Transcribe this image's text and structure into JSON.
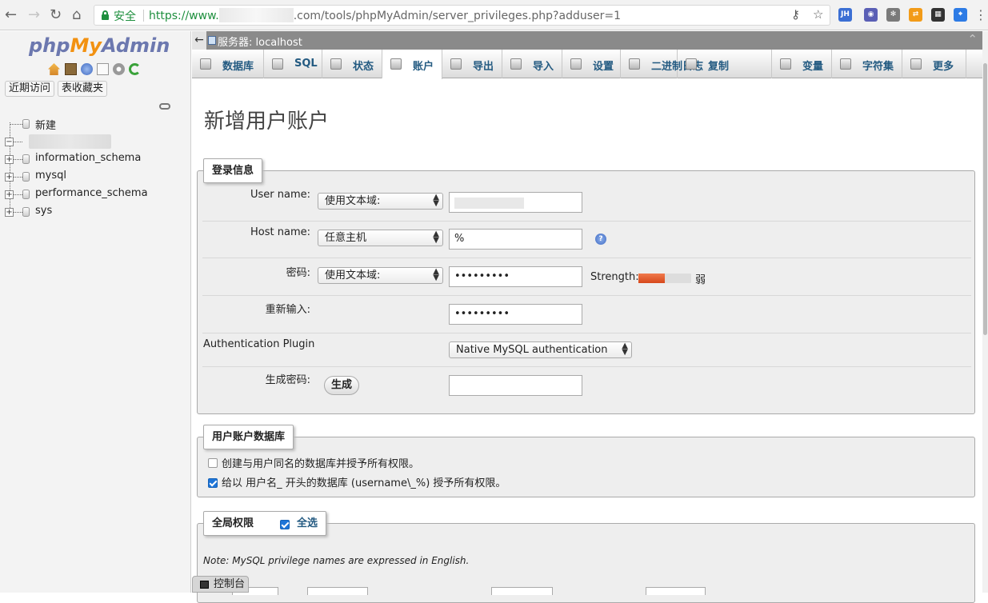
{
  "browser": {
    "secure_label": "安全",
    "url_proto": "https://www.",
    "url_rest": ".com/tools/phpMyAdmin/server_privileges.php?adduser=1",
    "extensions": [
      {
        "label": "JH",
        "color": "#3b6fd4"
      },
      {
        "label": "◉",
        "color": "#5a5fb5"
      },
      {
        "label": "✻",
        "color": "#7a7a7a"
      },
      {
        "label": "⇄",
        "color": "#f29b18"
      },
      {
        "label": "▦",
        "color": "#333333"
      },
      {
        "label": "⌖",
        "color": "#2d7be5"
      }
    ]
  },
  "sidebar": {
    "logo": {
      "php": "php",
      "my": "My",
      "admin": "Admin"
    },
    "quick_icons": [
      "home-icon",
      "logout-icon",
      "help-icon",
      "docs-icon",
      "settings-icon",
      "reload-icon"
    ],
    "recent_label": "近期访问",
    "favorites_label": "表收藏夹",
    "new_label": "新建",
    "databases": [
      "information_schema",
      "mysql",
      "performance_schema",
      "sys"
    ]
  },
  "topbar": {
    "server_label": "服务器: localhost"
  },
  "tabs": [
    {
      "label": "数据库",
      "icon": "database-icon",
      "active": false
    },
    {
      "label": "SQL",
      "icon": "sql-icon",
      "active": false
    },
    {
      "label": "状态",
      "icon": "status-icon",
      "active": false
    },
    {
      "label": "账户",
      "icon": "accounts-icon",
      "active": true
    },
    {
      "label": "导出",
      "icon": "export-icon",
      "active": false
    },
    {
      "label": "导入",
      "icon": "import-icon",
      "active": false
    },
    {
      "label": "设置",
      "icon": "settings-icon",
      "active": false
    },
    {
      "label": "二进制日志",
      "icon": "binlog-icon",
      "active": false
    },
    {
      "label": "复制",
      "icon": "replication-icon",
      "active": false
    },
    {
      "label": "变量",
      "icon": "variables-icon",
      "active": false
    },
    {
      "label": "字符集",
      "icon": "charset-icon",
      "active": false
    },
    {
      "label": "更多",
      "icon": "more-icon",
      "active": false
    }
  ],
  "page": {
    "title": "新增用户账户",
    "login_legend": "登录信息",
    "user_name_label": "User name:",
    "user_name_select": "使用文本域:",
    "host_name_label": "Host name:",
    "host_select": "任意主机",
    "host_value": "%",
    "password_label": "密码:",
    "password_select": "使用文本域:",
    "password_value": "•••••••••",
    "strength_label": "Strength:",
    "strength_fraction": 0.5,
    "strength_text": "弱",
    "reenter_label": "重新输入:",
    "reenter_value": "•••••••••",
    "auth_plugin_label": "Authentication Plugin",
    "auth_plugin_select": "Native MySQL authentication",
    "generate_label": "生成密码:",
    "generate_button": "生成",
    "db_legend": "用户账户数据库",
    "create_db_option": "创建与用户同名的数据库并授予所有权限。",
    "create_db_checked": false,
    "grant_wildcard_option": "给以 用户名_ 开头的数据库 (username\\_%) 授予所有权限。",
    "grant_wildcard_checked": true,
    "global_legend": "全局权限",
    "select_all_label": "全选",
    "select_all_checked": true,
    "note": "Note: MySQL privilege names are expressed in English."
  },
  "console": {
    "label": "控制台"
  }
}
